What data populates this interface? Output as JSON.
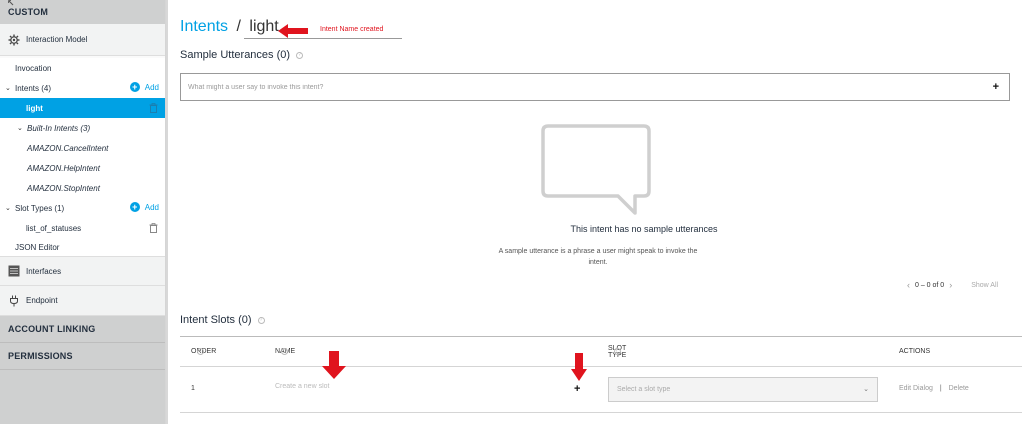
{
  "sidebar": {
    "custom_header": "CUSTOM",
    "interaction_model": "Interaction Model",
    "invocation": "Invocation",
    "intents": "Intents (4)",
    "intents_add": "Add",
    "selected_intent": "light",
    "builtin_intents": "Built-In Intents (3)",
    "builtin_items": [
      "AMAZON.CancelIntent",
      "AMAZON.HelpIntent",
      "AMAZON.StopIntent"
    ],
    "slot_types": "Slot Types (1)",
    "slot_types_add": "Add",
    "slot_type_item": "list_of_statuses",
    "json_editor": "JSON Editor",
    "interfaces": "Interfaces",
    "endpoint": "Endpoint",
    "account_linking": "ACCOUNT LINKING",
    "permissions": "PERMISSIONS"
  },
  "main": {
    "breadcrumb_intents": "Intents",
    "breadcrumb_sep": "/",
    "intent_name": "light",
    "annotation": "Intent Name created",
    "sample_utterances_title": "Sample Utterances (0)",
    "utterance_placeholder": "What might a user say to invoke this intent?",
    "utterance_add": "+",
    "empty_title": "This intent has no sample utterances",
    "empty_desc": "A sample utterance is a phrase a user might speak to invoke the intent.",
    "pager_text": "0 – 0 of 0",
    "show_all": "Show All",
    "intent_slots_title": "Intent Slots (0)",
    "columns": {
      "order": "ORDER",
      "name": "NAME",
      "slot_type": "SLOT TYPE",
      "actions": "ACTIONS"
    },
    "slot_row": {
      "order": "1",
      "name_placeholder": "Create a new slot",
      "add": "+",
      "slot_type_placeholder": "Select a slot type",
      "edit_dialog": "Edit Dialog",
      "divider": "|",
      "delete": "Delete"
    }
  },
  "colors": {
    "accent": "#00a1e4",
    "annotation_red": "#e0141e",
    "sidebar_header": "#cfd0d0"
  },
  "icons": [
    "gear-icon",
    "plus-circle-icon",
    "trash-icon",
    "interfaces-icon",
    "plug-icon",
    "info-icon",
    "speech-bubble-icon",
    "chevron-left-icon",
    "chevron-right-icon",
    "chevron-down-icon",
    "red-arrow-icon"
  ]
}
